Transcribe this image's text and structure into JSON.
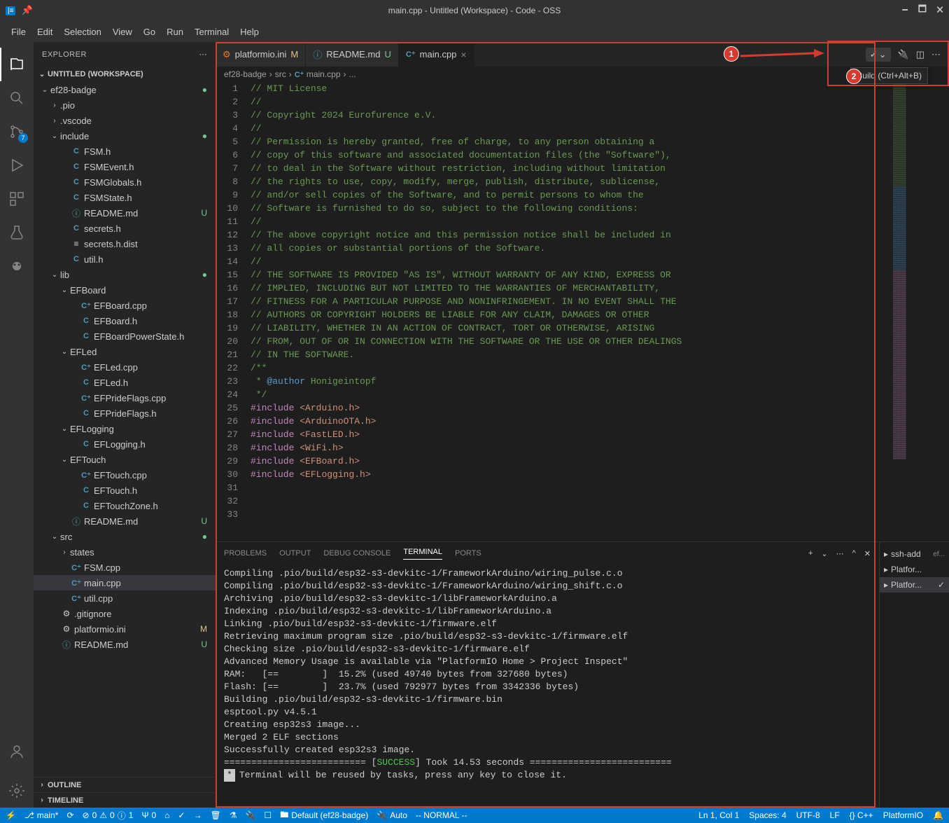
{
  "window": {
    "title": "main.cpp - Untitled (Workspace) - Code - OSS"
  },
  "menu": [
    "File",
    "Edit",
    "Selection",
    "View",
    "Go",
    "Run",
    "Terminal",
    "Help"
  ],
  "activitybar": {
    "badge": "7"
  },
  "sidebar": {
    "title": "EXPLORER",
    "workspace": "UNTITLED (WORKSPACE)",
    "tree": [
      {
        "name": "ef28-badge",
        "indent": 0,
        "folder": true,
        "open": true,
        "status": "dot"
      },
      {
        "name": ".pio",
        "indent": 1,
        "folder": true,
        "open": false
      },
      {
        "name": ".vscode",
        "indent": 1,
        "folder": true,
        "open": false
      },
      {
        "name": "include",
        "indent": 1,
        "folder": true,
        "open": true,
        "status": "dot"
      },
      {
        "name": "FSM.h",
        "indent": 2,
        "icon": "C"
      },
      {
        "name": "FSMEvent.h",
        "indent": 2,
        "icon": "C"
      },
      {
        "name": "FSMGlobals.h",
        "indent": 2,
        "icon": "C"
      },
      {
        "name": "FSMState.h",
        "indent": 2,
        "icon": "C"
      },
      {
        "name": "README.md",
        "indent": 2,
        "icon": "i",
        "status": "U"
      },
      {
        "name": "secrets.h",
        "indent": 2,
        "icon": "C"
      },
      {
        "name": "secrets.h.dist",
        "indent": 2,
        "icon": "≡"
      },
      {
        "name": "util.h",
        "indent": 2,
        "icon": "C"
      },
      {
        "name": "lib",
        "indent": 1,
        "folder": true,
        "open": true,
        "status": "dot"
      },
      {
        "name": "EFBoard",
        "indent": 2,
        "folder": true,
        "open": true
      },
      {
        "name": "EFBoard.cpp",
        "indent": 3,
        "icon": "C+"
      },
      {
        "name": "EFBoard.h",
        "indent": 3,
        "icon": "C"
      },
      {
        "name": "EFBoardPowerState.h",
        "indent": 3,
        "icon": "C"
      },
      {
        "name": "EFLed",
        "indent": 2,
        "folder": true,
        "open": true
      },
      {
        "name": "EFLed.cpp",
        "indent": 3,
        "icon": "C+"
      },
      {
        "name": "EFLed.h",
        "indent": 3,
        "icon": "C"
      },
      {
        "name": "EFPrideFlags.cpp",
        "indent": 3,
        "icon": "C+"
      },
      {
        "name": "EFPrideFlags.h",
        "indent": 3,
        "icon": "C"
      },
      {
        "name": "EFLogging",
        "indent": 2,
        "folder": true,
        "open": true
      },
      {
        "name": "EFLogging.h",
        "indent": 3,
        "icon": "C"
      },
      {
        "name": "EFTouch",
        "indent": 2,
        "folder": true,
        "open": true
      },
      {
        "name": "EFTouch.cpp",
        "indent": 3,
        "icon": "C+"
      },
      {
        "name": "EFTouch.h",
        "indent": 3,
        "icon": "C"
      },
      {
        "name": "EFTouchZone.h",
        "indent": 3,
        "icon": "C"
      },
      {
        "name": "README.md",
        "indent": 2,
        "icon": "i",
        "status": "U"
      },
      {
        "name": "src",
        "indent": 1,
        "folder": true,
        "open": true,
        "status": "dot"
      },
      {
        "name": "states",
        "indent": 2,
        "folder": true,
        "open": false
      },
      {
        "name": "FSM.cpp",
        "indent": 2,
        "icon": "C+"
      },
      {
        "name": "main.cpp",
        "indent": 2,
        "icon": "C+",
        "selected": true
      },
      {
        "name": "util.cpp",
        "indent": 2,
        "icon": "C+"
      },
      {
        "name": ".gitignore",
        "indent": 1,
        "icon": "⚙"
      },
      {
        "name": "platformio.ini",
        "indent": 1,
        "icon": "⚙",
        "status": "M"
      },
      {
        "name": "README.md",
        "indent": 1,
        "icon": "i",
        "status": "U"
      }
    ],
    "outline": "OUTLINE",
    "timeline": "TIMELINE"
  },
  "tabs": [
    {
      "label": "platformio.ini",
      "icon": "⚙",
      "status": "M"
    },
    {
      "label": "README.md",
      "icon": "i",
      "status": "U"
    },
    {
      "label": "main.cpp",
      "icon": "C+",
      "active": true,
      "close": true
    }
  ],
  "tooltip": "Build (Ctrl+Alt+B)",
  "breadcrumbs": [
    "ef28-badge",
    "src",
    "main.cpp",
    "..."
  ],
  "code": {
    "lines": [
      {
        "n": 1,
        "t": "// MIT License",
        "cls": "c-comment"
      },
      {
        "n": 2,
        "t": "//",
        "cls": "c-comment"
      },
      {
        "n": 3,
        "t": "// Copyright 2024 Eurofurence e.V.",
        "cls": "c-comment"
      },
      {
        "n": 4,
        "t": "//",
        "cls": "c-comment"
      },
      {
        "n": 5,
        "t": "// Permission is hereby granted, free of charge, to any person obtaining a",
        "cls": "c-comment"
      },
      {
        "n": 6,
        "t": "// copy of this software and associated documentation files (the \"Software\"),",
        "cls": "c-comment"
      },
      {
        "n": 7,
        "t": "// to deal in the Software without restriction, including without limitation",
        "cls": "c-comment"
      },
      {
        "n": 8,
        "t": "// the rights to use, copy, modify, merge, publish, distribute, sublicense,",
        "cls": "c-comment"
      },
      {
        "n": 9,
        "t": "// and/or sell copies of the Software, and to permit persons to whom the",
        "cls": "c-comment"
      },
      {
        "n": 10,
        "t": "// Software is furnished to do so, subject to the following conditions:",
        "cls": "c-comment"
      },
      {
        "n": 11,
        "t": "//",
        "cls": "c-comment"
      },
      {
        "n": 12,
        "t": "// The above copyright notice and this permission notice shall be included in",
        "cls": "c-comment"
      },
      {
        "n": 13,
        "t": "// all copies or substantial portions of the Software.",
        "cls": "c-comment"
      },
      {
        "n": 14,
        "t": "//",
        "cls": "c-comment"
      },
      {
        "n": 15,
        "t": "// THE SOFTWARE IS PROVIDED \"AS IS\", WITHOUT WARRANTY OF ANY KIND, EXPRESS OR",
        "cls": "c-comment"
      },
      {
        "n": 16,
        "t": "// IMPLIED, INCLUDING BUT NOT LIMITED TO THE WARRANTIES OF MERCHANTABILITY,",
        "cls": "c-comment"
      },
      {
        "n": 17,
        "t": "// FITNESS FOR A PARTICULAR PURPOSE AND NONINFRINGEMENT. IN NO EVENT SHALL THE",
        "cls": "c-comment"
      },
      {
        "n": 18,
        "t": "// AUTHORS OR COPYRIGHT HOLDERS BE LIABLE FOR ANY CLAIM, DAMAGES OR OTHER",
        "cls": "c-comment"
      },
      {
        "n": 19,
        "t": "// LIABILITY, WHETHER IN AN ACTION OF CONTRACT, TORT OR OTHERWISE, ARISING",
        "cls": "c-comment"
      },
      {
        "n": 20,
        "t": "// FROM, OUT OF OR IN CONNECTION WITH THE SOFTWARE OR THE USE OR OTHER DEALINGS",
        "cls": "c-comment"
      },
      {
        "n": 21,
        "t": "// IN THE SOFTWARE.",
        "cls": "c-comment"
      },
      {
        "n": 22,
        "t": "",
        "cls": ""
      },
      {
        "n": 23,
        "t": "/**",
        "cls": "c-comment"
      },
      {
        "n": 24,
        "html": "<span class='c-comment'> * </span><span class='c-tag'>@author</span><span class='c-comment'> Honigeintopf</span>"
      },
      {
        "n": 25,
        "t": " */",
        "cls": "c-comment"
      },
      {
        "n": 26,
        "t": "",
        "cls": ""
      },
      {
        "n": 27,
        "html": "<span class='c-keyword'>#include</span> <span class='c-string'>&lt;Arduino.h&gt;</span>"
      },
      {
        "n": 28,
        "html": "<span class='c-keyword'>#include</span> <span class='c-string'>&lt;ArduinoOTA.h&gt;</span>"
      },
      {
        "n": 29,
        "html": "<span class='c-keyword'>#include</span> <span class='c-string'>&lt;FastLED.h&gt;</span>"
      },
      {
        "n": 30,
        "html": "<span class='c-keyword'>#include</span> <span class='c-string'>&lt;WiFi.h&gt;</span>"
      },
      {
        "n": 31,
        "t": "",
        "cls": ""
      },
      {
        "n": 32,
        "html": "<span class='c-keyword'>#include</span> <span class='c-string'>&lt;EFBoard.h&gt;</span>"
      },
      {
        "n": 33,
        "html": "<span class='c-keyword'>#include</span> <span class='c-string'>&lt;EFLogging.h&gt;</span>"
      }
    ]
  },
  "panel": {
    "tabs": [
      "PROBLEMS",
      "OUTPUT",
      "DEBUG CONSOLE",
      "TERMINAL",
      "PORTS"
    ],
    "active": 3,
    "terminal_lines": [
      "Compiling .pio/build/esp32-s3-devkitc-1/FrameworkArduino/wiring_pulse.c.o",
      "Compiling .pio/build/esp32-s3-devkitc-1/FrameworkArduino/wiring_shift.c.o",
      "Archiving .pio/build/esp32-s3-devkitc-1/libFrameworkArduino.a",
      "Indexing .pio/build/esp32-s3-devkitc-1/libFrameworkArduino.a",
      "Linking .pio/build/esp32-s3-devkitc-1/firmware.elf",
      "Retrieving maximum program size .pio/build/esp32-s3-devkitc-1/firmware.elf",
      "Checking size .pio/build/esp32-s3-devkitc-1/firmware.elf",
      "Advanced Memory Usage is available via \"PlatformIO Home > Project Inspect\"",
      "RAM:   [==        ]  15.2% (used 49740 bytes from 327680 bytes)",
      "Flash: [==        ]  23.7% (used 792977 bytes from 3342336 bytes)",
      "Building .pio/build/esp32-s3-devkitc-1/firmware.bin",
      "esptool.py v4.5.1",
      "Creating esp32s3 image...",
      "Merged 2 ELF sections",
      "Successfully created esp32s3 image."
    ],
    "success_line_prefix": "========================== [",
    "success_word": "SUCCESS",
    "success_line_suffix": "] Took 14.53 seconds ==========================",
    "close_line": "Terminal will be reused by tasks, press any key to close it.",
    "side": [
      {
        "label": "ssh-add",
        "suffix": "ef..."
      },
      {
        "label": "Platfor..."
      },
      {
        "label": "Platfor...",
        "active": true,
        "check": true
      }
    ]
  },
  "status": {
    "left": [
      "main*",
      "0",
      "0",
      "1",
      "0"
    ],
    "default_env": "Default (ef28-badge)",
    "auto": "Auto",
    "normal": "-- NORMAL --",
    "right": [
      "Ln 1, Col 1",
      "Spaces: 4",
      "UTF-8",
      "LF",
      "{} C++",
      "PlatformIO"
    ]
  },
  "annotation": {
    "label1": "1",
    "label2": "2"
  }
}
